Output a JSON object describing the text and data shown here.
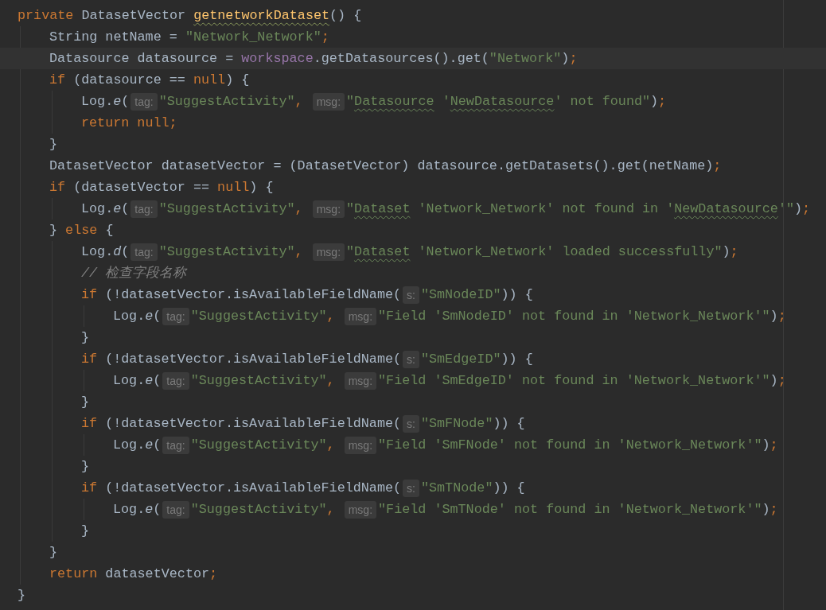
{
  "editor": {
    "lines": [
      {
        "current": false,
        "tokens": [
          {
            "kind": "keyword",
            "text": "private"
          },
          {
            "kind": "plain",
            "text": " DatasetVector "
          },
          {
            "kind": "declaration_typo",
            "text": "getnetworkDataset"
          },
          {
            "kind": "plain",
            "text": "() {"
          }
        ],
        "children": [
          {
            "current": false,
            "tokens": [
              {
                "kind": "plain",
                "text": "String netName = "
              },
              {
                "kind": "string",
                "text": "\"Network_Network\""
              },
              {
                "kind": "keyword",
                "text": ";"
              }
            ]
          },
          {
            "current": true,
            "tokens": [
              {
                "kind": "plain",
                "text": "Datasource datasource = "
              },
              {
                "kind": "field",
                "text": "workspace"
              },
              {
                "kind": "plain",
                "text": ".getDatasources().get("
              },
              {
                "kind": "string",
                "text": "\"Network\""
              },
              {
                "kind": "plain",
                "text": ")"
              },
              {
                "kind": "keyword",
                "text": ";"
              }
            ]
          },
          {
            "current": false,
            "tokens": [
              {
                "kind": "keyword",
                "text": "if"
              },
              {
                "kind": "plain",
                "text": " (datasource == "
              },
              {
                "kind": "keyword",
                "text": "null"
              },
              {
                "kind": "plain",
                "text": ") {"
              }
            ],
            "children": [
              {
                "current": false,
                "tokens": [
                  {
                    "kind": "plain",
                    "text": "Log."
                  },
                  {
                    "kind": "static_call",
                    "text": "e"
                  },
                  {
                    "kind": "plain",
                    "text": "("
                  },
                  {
                    "kind": "hint",
                    "text": "tag:"
                  },
                  {
                    "kind": "string",
                    "text": "\"SuggestActivity\""
                  },
                  {
                    "kind": "keyword",
                    "text": ", "
                  },
                  {
                    "kind": "hint",
                    "text": "msg:"
                  },
                  {
                    "kind": "string",
                    "text": "\""
                  },
                  {
                    "kind": "string_typo",
                    "text": "Datasource"
                  },
                  {
                    "kind": "string",
                    "text": " '"
                  },
                  {
                    "kind": "string_typo",
                    "text": "NewDatasource"
                  },
                  {
                    "kind": "string",
                    "text": "' not found\""
                  },
                  {
                    "kind": "plain",
                    "text": ")"
                  },
                  {
                    "kind": "keyword",
                    "text": ";"
                  }
                ]
              },
              {
                "current": false,
                "tokens": [
                  {
                    "kind": "keyword",
                    "text": "return null;"
                  }
                ]
              }
            ]
          },
          {
            "current": false,
            "tokens": [
              {
                "kind": "plain",
                "text": "}"
              }
            ]
          },
          {
            "current": false,
            "tokens": [
              {
                "kind": "plain",
                "text": "DatasetVector datasetVector = (DatasetVector) datasource.getDatasets().get(netName)"
              },
              {
                "kind": "keyword",
                "text": ";"
              }
            ]
          },
          {
            "current": false,
            "tokens": [
              {
                "kind": "keyword",
                "text": "if"
              },
              {
                "kind": "plain",
                "text": " (datasetVector == "
              },
              {
                "kind": "keyword",
                "text": "null"
              },
              {
                "kind": "plain",
                "text": ") {"
              }
            ],
            "children": [
              {
                "current": false,
                "tokens": [
                  {
                    "kind": "plain",
                    "text": "Log."
                  },
                  {
                    "kind": "static_call",
                    "text": "e"
                  },
                  {
                    "kind": "plain",
                    "text": "("
                  },
                  {
                    "kind": "hint",
                    "text": "tag:"
                  },
                  {
                    "kind": "string",
                    "text": "\"SuggestActivity\""
                  },
                  {
                    "kind": "keyword",
                    "text": ", "
                  },
                  {
                    "kind": "hint",
                    "text": "msg:"
                  },
                  {
                    "kind": "string",
                    "text": "\""
                  },
                  {
                    "kind": "string_typo",
                    "text": "Dataset"
                  },
                  {
                    "kind": "string",
                    "text": " 'Network_Network' not found in '"
                  },
                  {
                    "kind": "string_typo",
                    "text": "NewDatasource"
                  },
                  {
                    "kind": "string",
                    "text": "'\""
                  },
                  {
                    "kind": "plain",
                    "text": ")"
                  },
                  {
                    "kind": "keyword",
                    "text": ";"
                  }
                ]
              }
            ]
          },
          {
            "current": false,
            "tokens": [
              {
                "kind": "plain",
                "text": "} "
              },
              {
                "kind": "keyword",
                "text": "else"
              },
              {
                "kind": "plain",
                "text": " {"
              }
            ],
            "children": [
              {
                "current": false,
                "tokens": [
                  {
                    "kind": "plain",
                    "text": "Log."
                  },
                  {
                    "kind": "static_call",
                    "text": "d"
                  },
                  {
                    "kind": "plain",
                    "text": "("
                  },
                  {
                    "kind": "hint",
                    "text": "tag:"
                  },
                  {
                    "kind": "string",
                    "text": "\"SuggestActivity\""
                  },
                  {
                    "kind": "keyword",
                    "text": ", "
                  },
                  {
                    "kind": "hint",
                    "text": "msg:"
                  },
                  {
                    "kind": "string",
                    "text": "\""
                  },
                  {
                    "kind": "string_typo",
                    "text": "Dataset"
                  },
                  {
                    "kind": "string",
                    "text": " 'Network_Network' loaded successfully\""
                  },
                  {
                    "kind": "plain",
                    "text": ")"
                  },
                  {
                    "kind": "keyword",
                    "text": ";"
                  }
                ]
              },
              {
                "current": false,
                "tokens": [
                  {
                    "kind": "comment",
                    "text": "// 检查字段名称"
                  }
                ]
              },
              {
                "current": false,
                "tokens": [
                  {
                    "kind": "keyword",
                    "text": "if"
                  },
                  {
                    "kind": "plain",
                    "text": " (!datasetVector.isAvailableFieldName("
                  },
                  {
                    "kind": "hint",
                    "text": "s:"
                  },
                  {
                    "kind": "string",
                    "text": "\"SmNodeID\""
                  },
                  {
                    "kind": "plain",
                    "text": ")) {"
                  }
                ],
                "children": [
                  {
                    "current": false,
                    "tokens": [
                      {
                        "kind": "plain",
                        "text": "Log."
                      },
                      {
                        "kind": "static_call",
                        "text": "e"
                      },
                      {
                        "kind": "plain",
                        "text": "("
                      },
                      {
                        "kind": "hint",
                        "text": "tag:"
                      },
                      {
                        "kind": "string",
                        "text": "\"SuggestActivity\""
                      },
                      {
                        "kind": "keyword",
                        "text": ", "
                      },
                      {
                        "kind": "hint",
                        "text": "msg:"
                      },
                      {
                        "kind": "string",
                        "text": "\"Field 'SmNodeID' not found in 'Network_Network'\""
                      },
                      {
                        "kind": "plain",
                        "text": ")"
                      },
                      {
                        "kind": "keyword",
                        "text": ";"
                      }
                    ]
                  }
                ]
              },
              {
                "current": false,
                "tokens": [
                  {
                    "kind": "plain",
                    "text": "}"
                  }
                ]
              },
              {
                "current": false,
                "tokens": [
                  {
                    "kind": "keyword",
                    "text": "if"
                  },
                  {
                    "kind": "plain",
                    "text": " (!datasetVector.isAvailableFieldName("
                  },
                  {
                    "kind": "hint",
                    "text": "s:"
                  },
                  {
                    "kind": "string",
                    "text": "\"SmEdgeID\""
                  },
                  {
                    "kind": "plain",
                    "text": ")) {"
                  }
                ],
                "children": [
                  {
                    "current": false,
                    "tokens": [
                      {
                        "kind": "plain",
                        "text": "Log."
                      },
                      {
                        "kind": "static_call",
                        "text": "e"
                      },
                      {
                        "kind": "plain",
                        "text": "("
                      },
                      {
                        "kind": "hint",
                        "text": "tag:"
                      },
                      {
                        "kind": "string",
                        "text": "\"SuggestActivity\""
                      },
                      {
                        "kind": "keyword",
                        "text": ", "
                      },
                      {
                        "kind": "hint",
                        "text": "msg:"
                      },
                      {
                        "kind": "string",
                        "text": "\"Field 'SmEdgeID' not found in 'Network_Network'\""
                      },
                      {
                        "kind": "plain",
                        "text": ")"
                      },
                      {
                        "kind": "keyword",
                        "text": ";"
                      }
                    ]
                  }
                ]
              },
              {
                "current": false,
                "tokens": [
                  {
                    "kind": "plain",
                    "text": "}"
                  }
                ]
              },
              {
                "current": false,
                "tokens": [
                  {
                    "kind": "keyword",
                    "text": "if"
                  },
                  {
                    "kind": "plain",
                    "text": " (!datasetVector.isAvailableFieldName("
                  },
                  {
                    "kind": "hint",
                    "text": "s:"
                  },
                  {
                    "kind": "string",
                    "text": "\"SmFNode\""
                  },
                  {
                    "kind": "plain",
                    "text": ")) {"
                  }
                ],
                "children": [
                  {
                    "current": false,
                    "tokens": [
                      {
                        "kind": "plain",
                        "text": "Log."
                      },
                      {
                        "kind": "static_call",
                        "text": "e"
                      },
                      {
                        "kind": "plain",
                        "text": "("
                      },
                      {
                        "kind": "hint",
                        "text": "tag:"
                      },
                      {
                        "kind": "string",
                        "text": "\"SuggestActivity\""
                      },
                      {
                        "kind": "keyword",
                        "text": ", "
                      },
                      {
                        "kind": "hint",
                        "text": "msg:"
                      },
                      {
                        "kind": "string",
                        "text": "\"Field 'SmFNode' not found in 'Network_Network'\""
                      },
                      {
                        "kind": "plain",
                        "text": ")"
                      },
                      {
                        "kind": "keyword",
                        "text": ";"
                      }
                    ]
                  }
                ]
              },
              {
                "current": false,
                "tokens": [
                  {
                    "kind": "plain",
                    "text": "}"
                  }
                ]
              },
              {
                "current": false,
                "tokens": [
                  {
                    "kind": "keyword",
                    "text": "if"
                  },
                  {
                    "kind": "plain",
                    "text": " (!datasetVector.isAvailableFieldName("
                  },
                  {
                    "kind": "hint",
                    "text": "s:"
                  },
                  {
                    "kind": "string",
                    "text": "\"SmTNode\""
                  },
                  {
                    "kind": "plain",
                    "text": ")) {"
                  }
                ],
                "children": [
                  {
                    "current": false,
                    "tokens": [
                      {
                        "kind": "plain",
                        "text": "Log."
                      },
                      {
                        "kind": "static_call",
                        "text": "e"
                      },
                      {
                        "kind": "plain",
                        "text": "("
                      },
                      {
                        "kind": "hint",
                        "text": "tag:"
                      },
                      {
                        "kind": "string",
                        "text": "\"SuggestActivity\""
                      },
                      {
                        "kind": "keyword",
                        "text": ", "
                      },
                      {
                        "kind": "hint",
                        "text": "msg:"
                      },
                      {
                        "kind": "string",
                        "text": "\"Field 'SmTNode' not found in 'Network_Network'\""
                      },
                      {
                        "kind": "plain",
                        "text": ")"
                      },
                      {
                        "kind": "keyword",
                        "text": ";"
                      }
                    ]
                  }
                ]
              },
              {
                "current": false,
                "tokens": [
                  {
                    "kind": "plain",
                    "text": "}"
                  }
                ]
              }
            ]
          },
          {
            "current": false,
            "tokens": [
              {
                "kind": "plain",
                "text": "}"
              }
            ]
          },
          {
            "current": false,
            "tokens": [
              {
                "kind": "keyword",
                "text": "return"
              },
              {
                "kind": "plain",
                "text": " datasetVector"
              },
              {
                "kind": "keyword",
                "text": ";"
              }
            ]
          }
        ]
      },
      {
        "current": false,
        "tokens": [
          {
            "kind": "plain",
            "text": "}"
          }
        ]
      }
    ]
  }
}
